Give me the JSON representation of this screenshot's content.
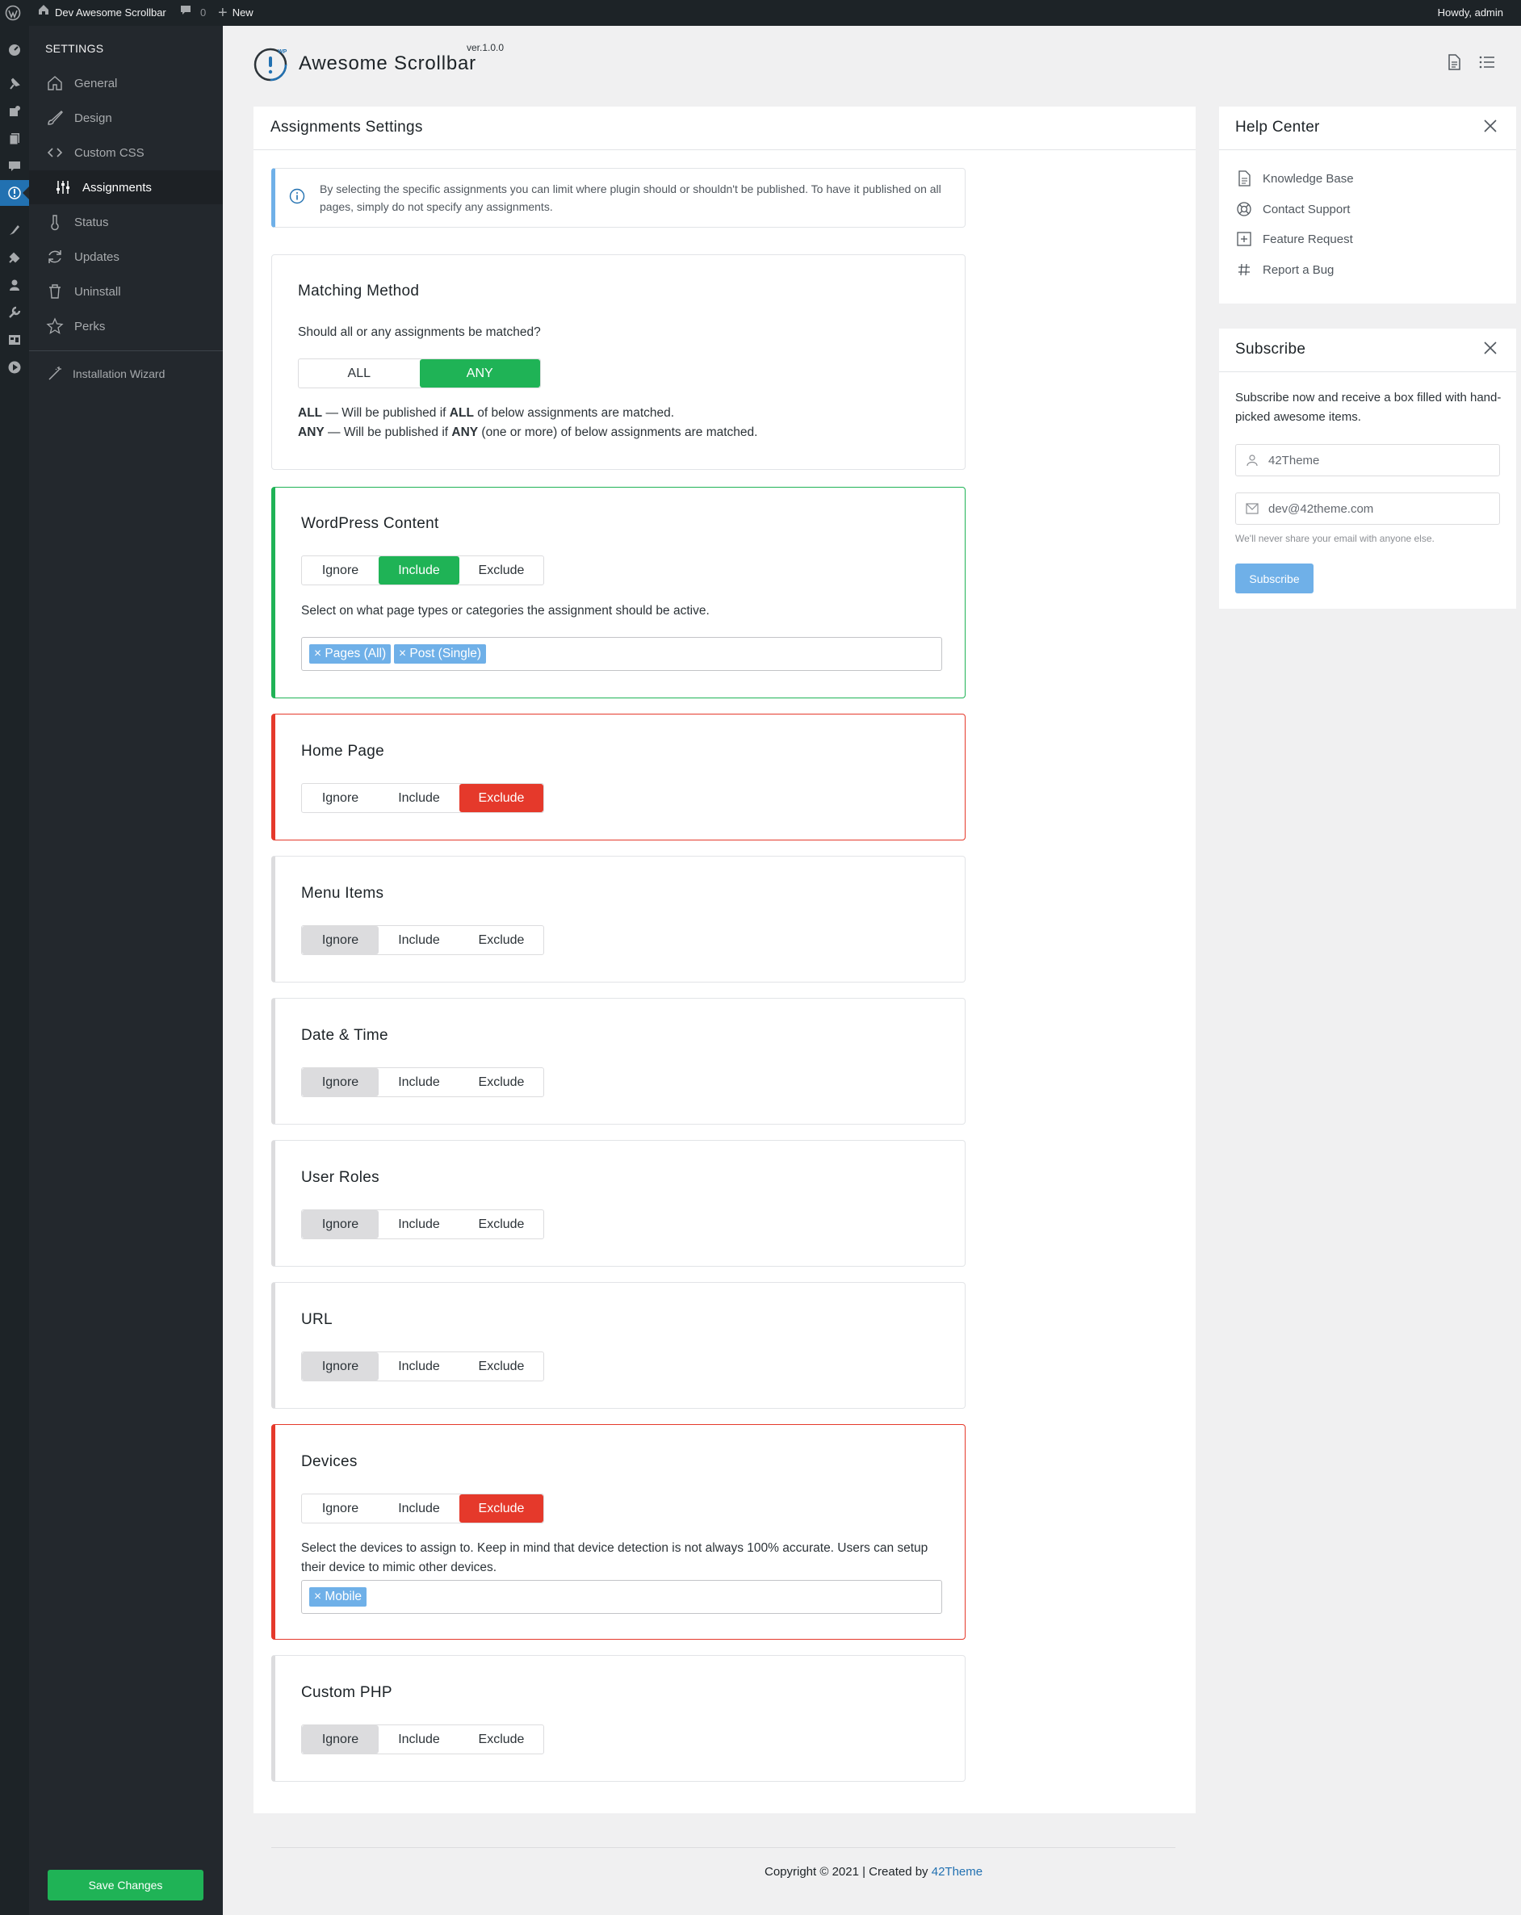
{
  "admin_bar": {
    "site_name": "Dev Awesome Scrollbar",
    "comments_count": "0",
    "new_label": "New",
    "greeting": "Howdy, admin"
  },
  "sidebar": {
    "header": "SETTINGS",
    "items": [
      {
        "label": "General",
        "icon": "home-icon"
      },
      {
        "label": "Design",
        "icon": "brush-icon"
      },
      {
        "label": "Custom CSS",
        "icon": "code-icon"
      },
      {
        "label": "Assignments",
        "icon": "sliders-icon",
        "active": true
      },
      {
        "label": "Status",
        "icon": "thermometer-icon"
      },
      {
        "label": "Updates",
        "icon": "refresh-icon"
      },
      {
        "label": "Uninstall",
        "icon": "trash-icon"
      },
      {
        "label": "Perks",
        "icon": "star-icon"
      },
      {
        "label": "Installation Wizard",
        "icon": "wand-icon"
      }
    ],
    "save_label": "Save Changes"
  },
  "header": {
    "title": "Awesome Scrollbar",
    "version": "ver.1.0.0",
    "logo_badge": "WP"
  },
  "main": {
    "title": "Assignments Settings",
    "info": "By selecting the specific assignments you can limit where plugin should or shouldn't be published. To have it published on all pages, simply do not specify any assignments.",
    "matching": {
      "title": "Matching Method",
      "question": "Should all or any assignments be matched?",
      "options": [
        "ALL",
        "ANY"
      ],
      "selected": "ANY",
      "all_key": "ALL",
      "all_desc_a": " — Will be published if ",
      "all_desc_b": "ALL",
      "all_desc_c": " of below assignments are matched.",
      "any_key": "ANY",
      "any_desc_a": " — Will be published if ",
      "any_desc_b": "ANY",
      "any_desc_c": " (one or more) of below assignments are matched."
    },
    "segment_labels": [
      "Ignore",
      "Include",
      "Exclude"
    ],
    "sections": {
      "wordpress": {
        "title": "WordPress Content",
        "state": "Include",
        "desc": "Select on what page types or categories the assignment should be active.",
        "tags": [
          "Pages (All)",
          "Post (Single)"
        ]
      },
      "home": {
        "title": "Home Page",
        "state": "Exclude"
      },
      "menu": {
        "title": "Menu Items",
        "state": "Ignore"
      },
      "datetime": {
        "title": "Date & Time",
        "state": "Ignore"
      },
      "roles": {
        "title": "User Roles",
        "state": "Ignore"
      },
      "url": {
        "title": "URL",
        "state": "Ignore"
      },
      "devices": {
        "title": "Devices",
        "state": "Exclude",
        "desc": "Select the devices to assign to. Keep in mind that device detection is not always 100% accurate. Users can setup their device to mimic other devices.",
        "tags": [
          "Mobile"
        ]
      },
      "php": {
        "title": "Custom PHP",
        "state": "Ignore"
      }
    }
  },
  "help_center": {
    "title": "Help Center",
    "items": [
      {
        "label": "Knowledge Base",
        "icon": "document-icon"
      },
      {
        "label": "Contact Support",
        "icon": "lifebuoy-icon"
      },
      {
        "label": "Feature Request",
        "icon": "plus-square-icon"
      },
      {
        "label": "Report a Bug",
        "icon": "hash-icon"
      }
    ]
  },
  "subscribe": {
    "title": "Subscribe",
    "text": "Subscribe now and receive a box filled with hand-picked awesome items.",
    "name_value": "42Theme",
    "email_value": "dev@42theme.com",
    "note": "We'll never share your email with anyone else.",
    "button": "Subscribe"
  },
  "footer": {
    "text": "Copyright © 2021 | Created by ",
    "link": "42Theme"
  },
  "colors": {
    "accent_green": "#1fb356",
    "exclude_red": "#e5392b",
    "tag_blue": "#6fb0e8",
    "link_blue": "#2271b1"
  }
}
